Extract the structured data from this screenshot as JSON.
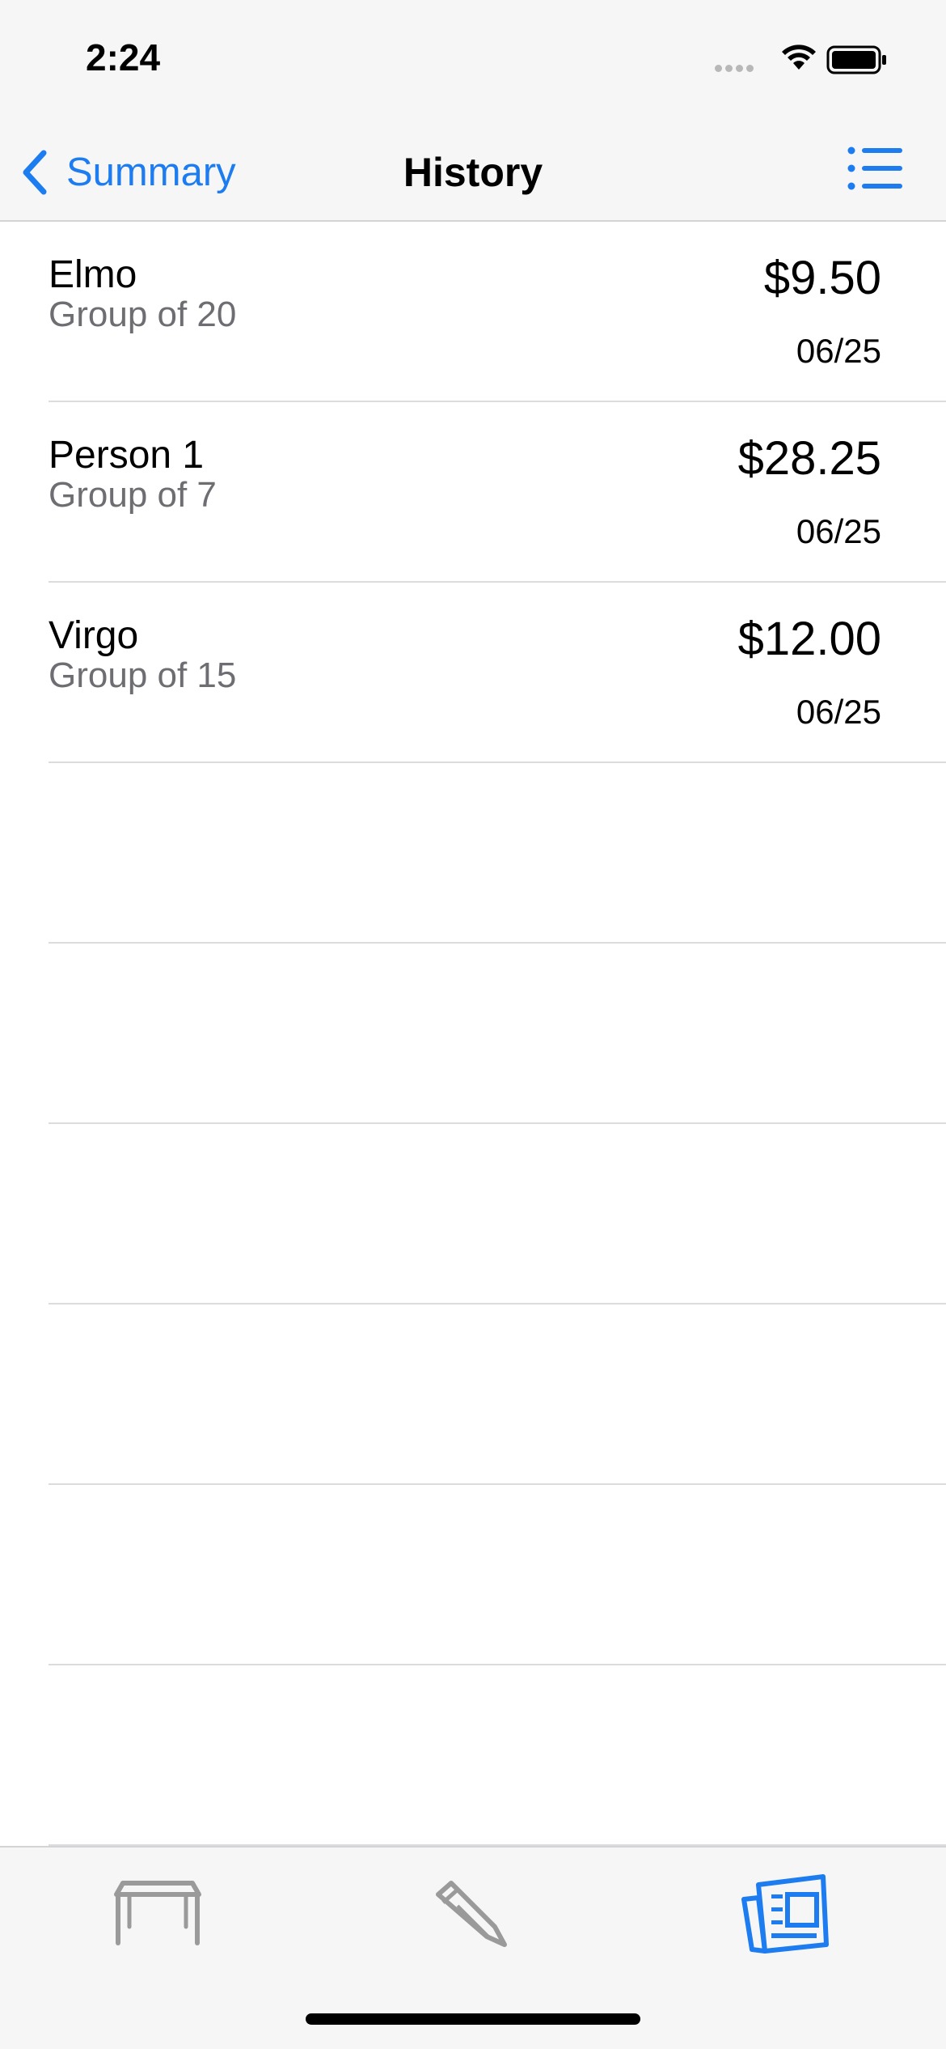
{
  "status_bar": {
    "time": "2:24",
    "icons": [
      "cellular-signal-icon",
      "wifi-icon",
      "battery-icon"
    ]
  },
  "nav": {
    "back_label": "Summary",
    "title": "History",
    "right_icon": "list-icon"
  },
  "history": [
    {
      "name": "Elmo",
      "group": "Group of 20",
      "amount": "$9.50",
      "date": "06/25"
    },
    {
      "name": "Person 1",
      "group": "Group of 7",
      "amount": "$28.25",
      "date": "06/25"
    },
    {
      "name": "Virgo",
      "group": "Group of 15",
      "amount": "$12.00",
      "date": "06/25"
    }
  ],
  "tab_bar": {
    "tabs": [
      {
        "icon": "table-icon",
        "selected": false
      },
      {
        "icon": "pencil-icon",
        "selected": false
      },
      {
        "icon": "newspaper-icon",
        "selected": true
      }
    ]
  },
  "colors": {
    "accent": "#1c7cf0",
    "inactive": "#999999",
    "secondary_text": "#6d6d72",
    "bar_background": "#f6f6f6"
  }
}
